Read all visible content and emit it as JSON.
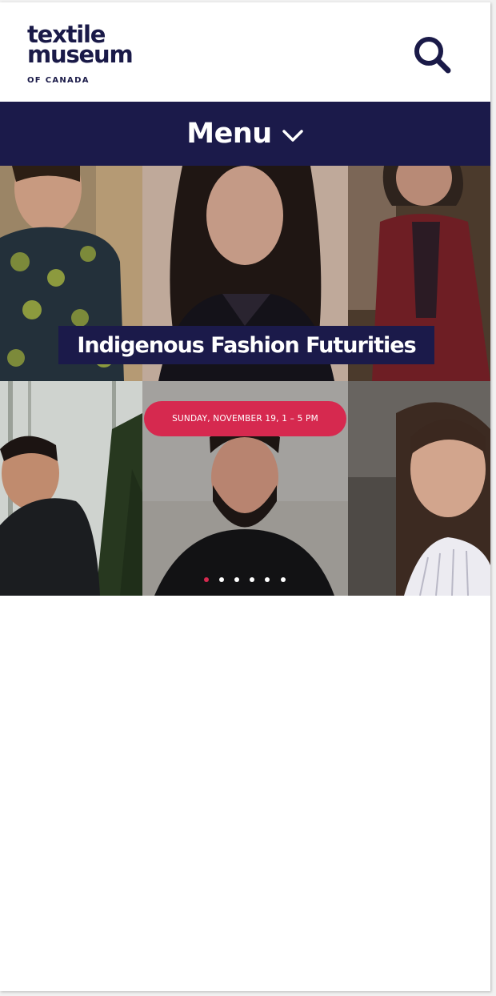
{
  "header": {
    "logo": {
      "line1": "textile",
      "line2": "museum",
      "line3": "OF CANADA"
    },
    "search_icon": "search-icon"
  },
  "nav": {
    "menu_label": "Menu",
    "menu_icon": "chevron-down-icon"
  },
  "hero": {
    "title": "Indigenous Fashion Futurities",
    "date": "SUNDAY, NOVEMBER 19, 1 – 5 PM",
    "slide_count": 6,
    "active_slide": 1
  },
  "colors": {
    "brand_navy": "#1b1a4a",
    "accent_red": "#d6294f",
    "white": "#ffffff"
  }
}
